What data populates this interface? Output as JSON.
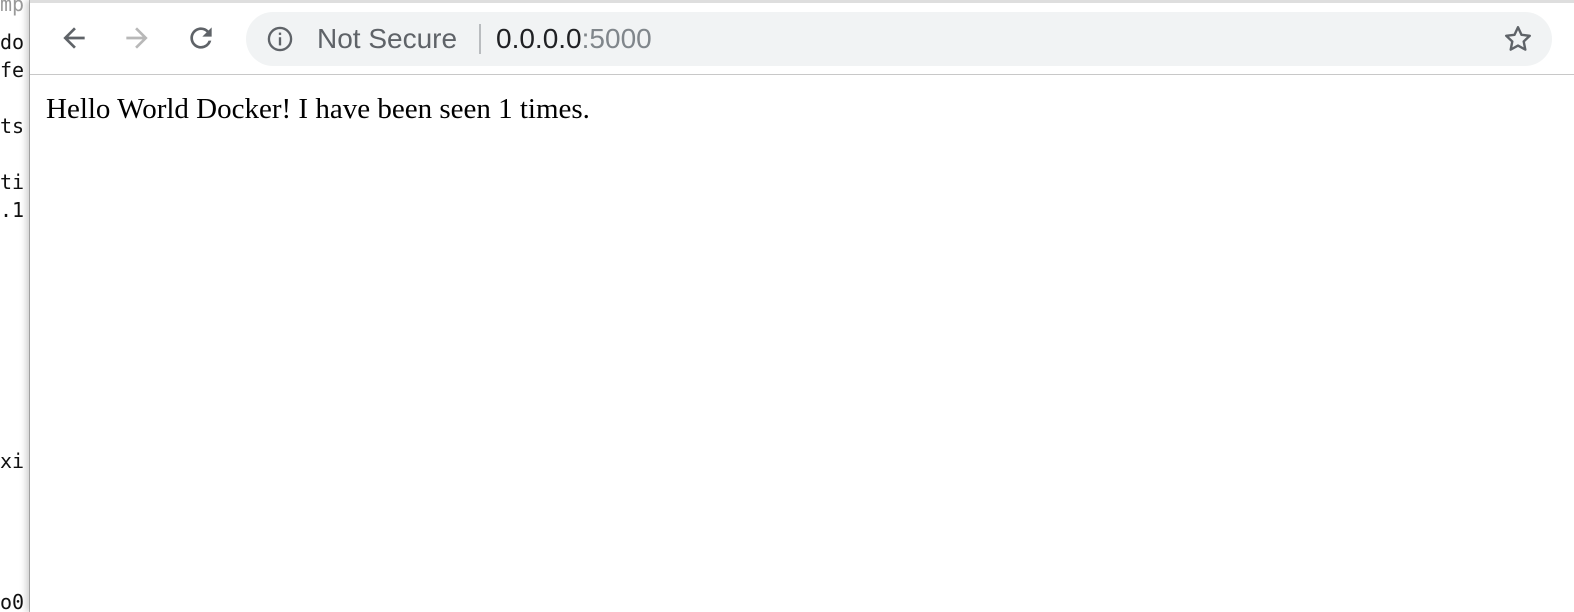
{
  "background_terminal": {
    "lines": [
      "mp",
      "do",
      "fe",
      "ts",
      "ti",
      ".1",
      "xi",
      "o0"
    ]
  },
  "browser": {
    "toolbar": {
      "back_icon": "arrow-left-icon",
      "forward_icon": "arrow-right-icon",
      "reload_icon": "reload-icon",
      "forward_enabled": false
    },
    "omnibox": {
      "security_icon": "info-icon",
      "security_label": "Not Secure",
      "url_host": "0.0.0.0",
      "url_port": ":5000",
      "bookmark_icon": "star-icon"
    }
  },
  "page": {
    "body_text": "Hello World Docker! I have been seen 1 times."
  },
  "colors": {
    "omnibox_background": "#f1f3f4",
    "icon_active": "#5f6368",
    "icon_disabled": "#b8b8b8",
    "url_port": "#80868b"
  }
}
